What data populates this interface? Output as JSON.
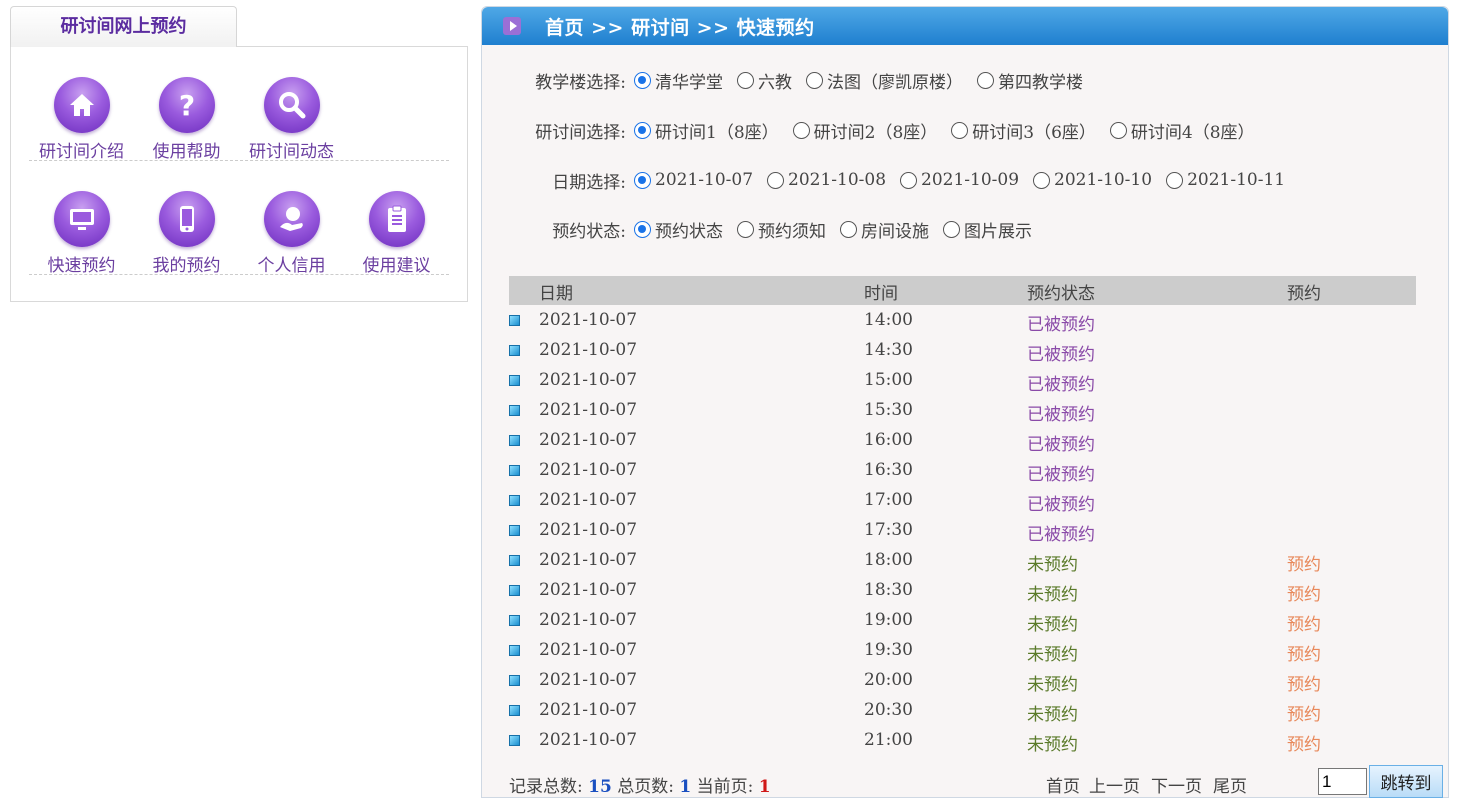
{
  "left": {
    "tab_title": "研讨间网上预约",
    "row1": [
      {
        "label": "研讨间介绍",
        "icon": "home-icon"
      },
      {
        "label": "使用帮助",
        "icon": "help-icon"
      },
      {
        "label": "研讨间动态",
        "icon": "search-icon"
      }
    ],
    "row2": [
      {
        "label": "快速预约",
        "icon": "monitor-icon"
      },
      {
        "label": "我的预约",
        "icon": "phone-icon"
      },
      {
        "label": "个人信用",
        "icon": "user-hand-icon"
      },
      {
        "label": "使用建议",
        "icon": "clipboard-icon"
      }
    ]
  },
  "header": {
    "breadcrumb": "首页 >> 研讨间 >> 快速预约"
  },
  "filters": {
    "building": {
      "label": "教学楼选择:",
      "options": [
        "清华学堂",
        "六教",
        "法图（廖凯原楼）",
        "第四教学楼"
      ],
      "selected": 0
    },
    "room": {
      "label": "研讨间选择:",
      "options": [
        "研讨间1（8座）",
        "研讨间2（8座）",
        "研讨间3（6座）",
        "研讨间4（8座）"
      ],
      "selected": 0
    },
    "date": {
      "label": "日期选择:",
      "options": [
        "2021-10-07",
        "2021-10-08",
        "2021-10-09",
        "2021-10-10",
        "2021-10-11"
      ],
      "selected": 0
    },
    "status": {
      "label": "预约状态:",
      "options": [
        "预约状态",
        "预约须知",
        "房间设施",
        "图片展示"
      ],
      "selected": 0
    }
  },
  "table": {
    "headers": {
      "date": "日期",
      "time": "时间",
      "status": "预约状态",
      "reserve": "预约"
    },
    "rows": [
      {
        "date": "2021-10-07",
        "time": "14:00",
        "status": "已被预约",
        "reserve": ""
      },
      {
        "date": "2021-10-07",
        "time": "14:30",
        "status": "已被预约",
        "reserve": ""
      },
      {
        "date": "2021-10-07",
        "time": "15:00",
        "status": "已被预约",
        "reserve": ""
      },
      {
        "date": "2021-10-07",
        "time": "15:30",
        "status": "已被预约",
        "reserve": ""
      },
      {
        "date": "2021-10-07",
        "time": "16:00",
        "status": "已被预约",
        "reserve": ""
      },
      {
        "date": "2021-10-07",
        "time": "16:30",
        "status": "已被预约",
        "reserve": ""
      },
      {
        "date": "2021-10-07",
        "time": "17:00",
        "status": "已被预约",
        "reserve": ""
      },
      {
        "date": "2021-10-07",
        "time": "17:30",
        "status": "已被预约",
        "reserve": ""
      },
      {
        "date": "2021-10-07",
        "time": "18:00",
        "status": "未预约",
        "reserve": "预约"
      },
      {
        "date": "2021-10-07",
        "time": "18:30",
        "status": "未预约",
        "reserve": "预约"
      },
      {
        "date": "2021-10-07",
        "time": "19:00",
        "status": "未预约",
        "reserve": "预约"
      },
      {
        "date": "2021-10-07",
        "time": "19:30",
        "status": "未预约",
        "reserve": "预约"
      },
      {
        "date": "2021-10-07",
        "time": "20:00",
        "status": "未预约",
        "reserve": "预约"
      },
      {
        "date": "2021-10-07",
        "time": "20:30",
        "status": "未预约",
        "reserve": "预约"
      },
      {
        "date": "2021-10-07",
        "time": "21:00",
        "status": "未预约",
        "reserve": "预约"
      }
    ]
  },
  "footer": {
    "total_label": "记录总数:",
    "total": "15",
    "pages_label": "总页数:",
    "pages": "1",
    "current_label": "当前页:",
    "current": "1",
    "first": "首页",
    "prev": "上一页",
    "next": "下一页",
    "last": "尾页",
    "page_input": "1",
    "jump": "跳转到"
  },
  "colors": {
    "header_blue": "#1f7fcf",
    "booked": "#8a4aa8",
    "free": "#5a7a2a",
    "reserve_link": "#e8885a",
    "icon_purple": "#9a5bde"
  }
}
